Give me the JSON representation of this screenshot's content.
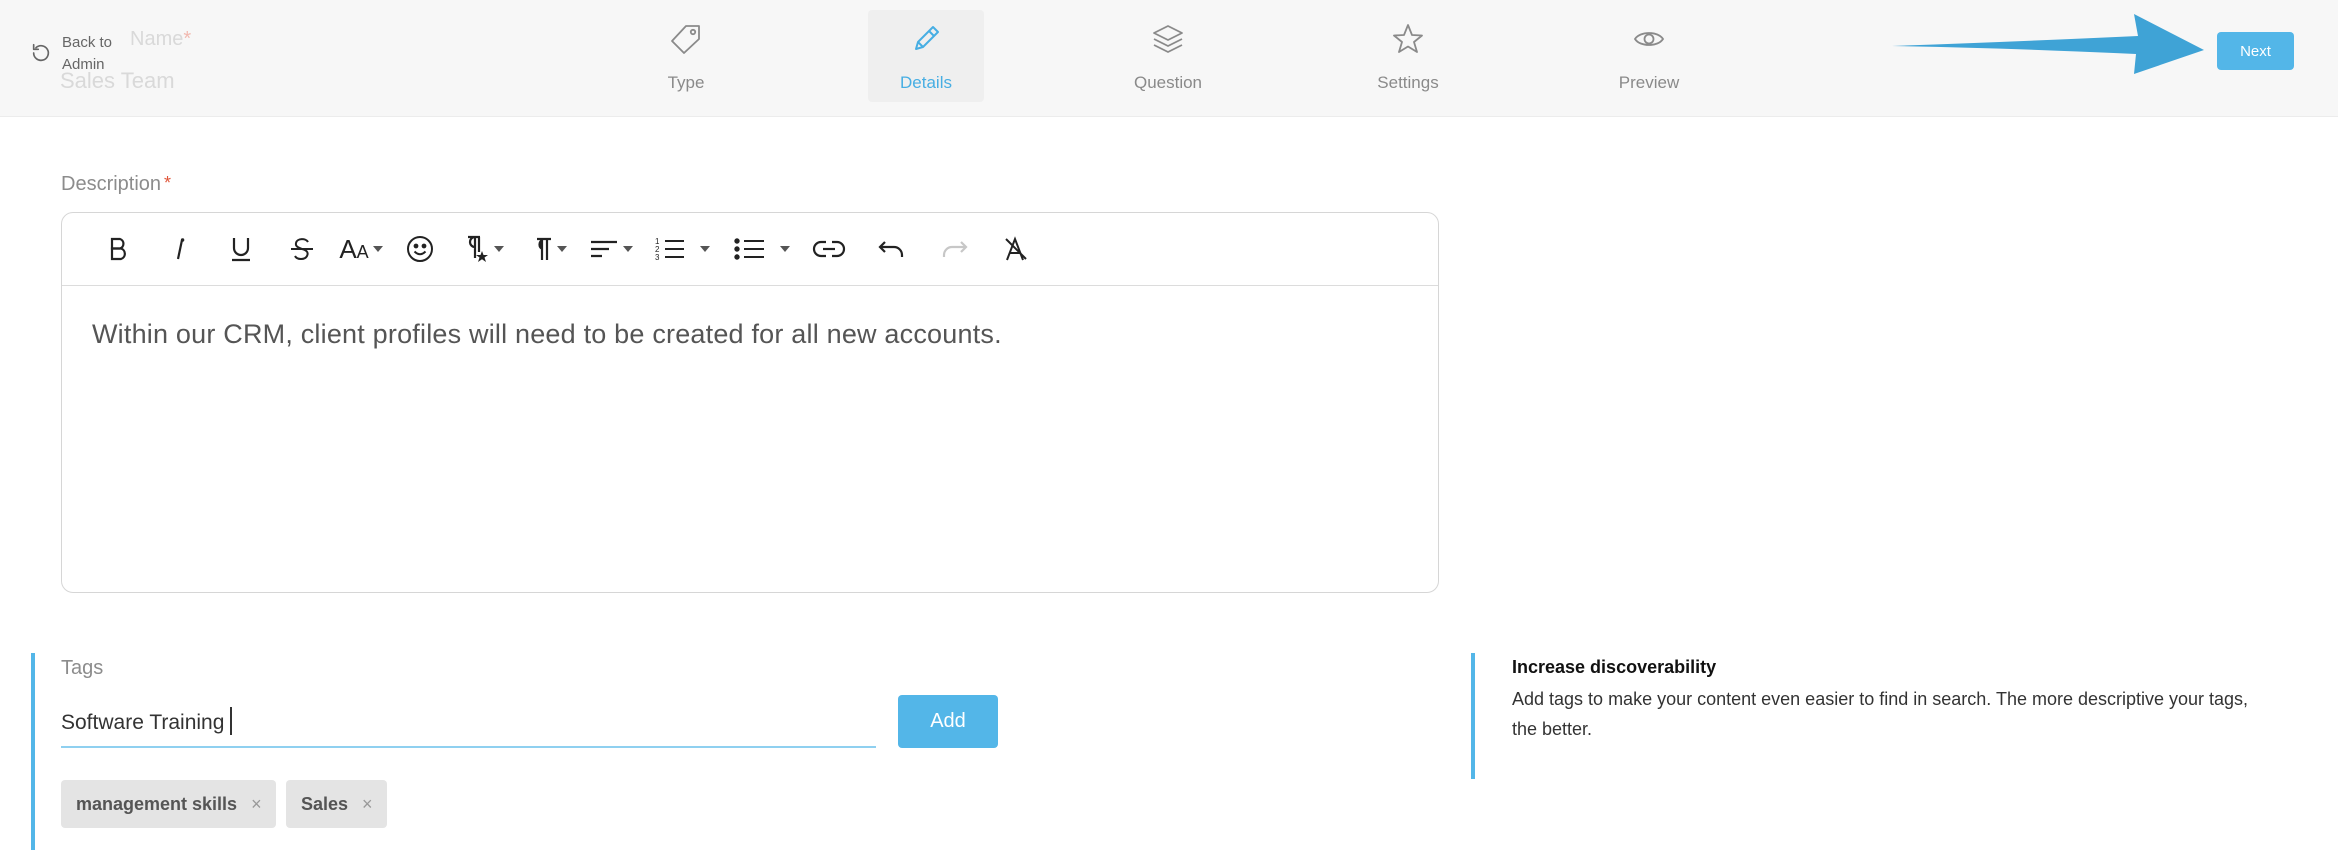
{
  "header": {
    "back_label": "Back to Admin",
    "ghost_name_label": "Name",
    "ghost_name_value": "Sales Team",
    "steps": [
      {
        "label": "Type",
        "icon": "tag-icon",
        "active": false
      },
      {
        "label": "Details",
        "icon": "pencil-icon",
        "active": true
      },
      {
        "label": "Question",
        "icon": "layers-icon",
        "active": false
      },
      {
        "label": "Settings",
        "icon": "star-icon",
        "active": false
      },
      {
        "label": "Preview",
        "icon": "eye-icon",
        "active": false
      }
    ],
    "next_label": "Next"
  },
  "description": {
    "label": "Description",
    "required_mark": "*",
    "content": "Within our CRM, client profiles will need to be created for all new accounts.",
    "toolbar": [
      "bold",
      "italic",
      "underline",
      "strikethrough",
      "font-size",
      "emoji",
      "paragraph-style",
      "paragraph-format",
      "align",
      "ordered-list",
      "unordered-list",
      "link",
      "undo",
      "redo",
      "clear-formatting"
    ]
  },
  "tags": {
    "label": "Tags",
    "input_value": "Software Training",
    "add_label": "Add",
    "chips": [
      {
        "label": "management skills",
        "remove": "×"
      },
      {
        "label": "Sales",
        "remove": "×"
      }
    ]
  },
  "info": {
    "title": "Increase discoverability",
    "text": "Add tags to make your content even easier to find in search. The more descriptive your tags, the better."
  },
  "colors": {
    "accent": "#53b6e8",
    "active_step": "#47aee3",
    "required": "#e0563a",
    "arrow": "#3fa3d6"
  }
}
